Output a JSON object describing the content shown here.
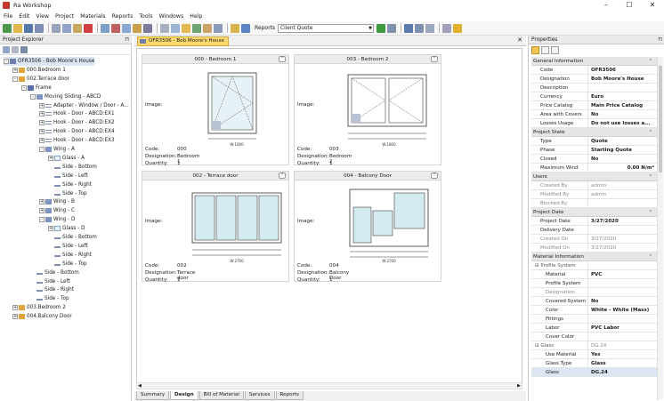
{
  "app": {
    "title": "Ra Workshop"
  },
  "window_controls": {
    "minimize": "–",
    "maximize": "☐",
    "close": "✕"
  },
  "menu": [
    "File",
    "Edit",
    "View",
    "Project",
    "Materials",
    "Reports",
    "Tools",
    "Windows",
    "Help"
  ],
  "toolbar": {
    "reports_label": "Reports",
    "report_select_value": "Client Quote"
  },
  "explorer": {
    "title": "Project Explorer",
    "tree": [
      {
        "label": "OFR3506 - Bob Moore's House",
        "level": 0,
        "icon": "project-icon",
        "expander": "-",
        "selected": true
      },
      {
        "label": "000.Bedroom 1",
        "level": 1,
        "icon": "window-icon",
        "expander": "+"
      },
      {
        "label": "002.Terrace door",
        "level": 1,
        "icon": "window-icon",
        "expander": "-"
      },
      {
        "label": "Frame",
        "level": 2,
        "icon": "frame-icon",
        "expander": "-"
      },
      {
        "label": "Moving Sliding - ABCD",
        "level": 3,
        "icon": "sash-icon",
        "expander": "-"
      },
      {
        "label": "Adapter - Window / Door - A...",
        "level": 4,
        "icon": "adapter-icon",
        "expander": "+"
      },
      {
        "label": "Hook - Door - ABCD:EX1",
        "level": 4,
        "icon": "adapter-icon",
        "expander": "+"
      },
      {
        "label": "Hook - Door - ABCD:EX2",
        "level": 4,
        "icon": "adapter-icon",
        "expander": "+"
      },
      {
        "label": "Hook - Door - ABCD:EX4",
        "level": 4,
        "icon": "adapter-icon",
        "expander": "+"
      },
      {
        "label": "Hook - Door - ABCD:EX3",
        "level": 4,
        "icon": "adapter-icon",
        "expander": "+"
      },
      {
        "label": "Wing - A",
        "level": 4,
        "icon": "sash-icon",
        "expander": "-"
      },
      {
        "label": "Glass - A",
        "level": 5,
        "icon": "glass-icon",
        "expander": "+"
      },
      {
        "label": "Side - Bottom",
        "level": 5,
        "icon": "side-icon",
        "expander": ""
      },
      {
        "label": "Side - Left",
        "level": 5,
        "icon": "side-icon",
        "expander": ""
      },
      {
        "label": "Side - Right",
        "level": 5,
        "icon": "side-icon",
        "expander": ""
      },
      {
        "label": "Side - Top",
        "level": 5,
        "icon": "side-icon",
        "expander": ""
      },
      {
        "label": "Wing - B",
        "level": 4,
        "icon": "sash-icon",
        "expander": "+"
      },
      {
        "label": "Wing - C",
        "level": 4,
        "icon": "sash-icon",
        "expander": "+"
      },
      {
        "label": "Wing - D",
        "level": 4,
        "icon": "sash-icon",
        "expander": "-"
      },
      {
        "label": "Glass - D",
        "level": 5,
        "icon": "glass-icon",
        "expander": "+"
      },
      {
        "label": "Side - Bottom",
        "level": 5,
        "icon": "side-icon",
        "expander": ""
      },
      {
        "label": "Side - Left",
        "level": 5,
        "icon": "side-icon",
        "expander": ""
      },
      {
        "label": "Side - Right",
        "level": 5,
        "icon": "side-icon",
        "expander": ""
      },
      {
        "label": "Side - Top",
        "level": 5,
        "icon": "side-icon",
        "expander": ""
      },
      {
        "label": "Side - Bottom",
        "level": 3,
        "icon": "side-icon",
        "expander": ""
      },
      {
        "label": "Side - Left",
        "level": 3,
        "icon": "side-icon",
        "expander": ""
      },
      {
        "label": "Side - Right",
        "level": 3,
        "icon": "side-icon",
        "expander": ""
      },
      {
        "label": "Side - Top",
        "level": 3,
        "icon": "side-icon",
        "expander": ""
      },
      {
        "label": "003.Bedroom 2",
        "level": 1,
        "icon": "window-icon",
        "expander": "+"
      },
      {
        "label": "004.Balcony Door",
        "level": 1,
        "icon": "window-icon",
        "expander": "+"
      }
    ]
  },
  "document": {
    "tab_label": "OFR3506 - Bob Moore's House",
    "close_glyph": "✕",
    "cards": [
      {
        "title": "000 - Bedroom 1",
        "image_label": "Image:",
        "code_label": "Code:",
        "code": "000",
        "designation_label": "Designation:",
        "designation": "Bedroom 1",
        "quantity_label": "Quantity:",
        "quantity": "1",
        "width_label": "W:1000"
      },
      {
        "title": "003 - Bedroom 2",
        "image_label": "Image:",
        "code_label": "Code:",
        "code": "003",
        "designation_label": "Designation:",
        "designation": "Bedroom 2",
        "quantity_label": "Quantity:",
        "quantity": "1",
        "width_label": "W:1800"
      },
      {
        "title": "002 - Terrace door",
        "image_label": "Image:",
        "code_label": "Code:",
        "code": "002",
        "designation_label": "Designation:",
        "designation": "Terrace door",
        "quantity_label": "Quantity:",
        "quantity": "1",
        "width_label": "W:2700"
      },
      {
        "title": "004 - Balcony Door",
        "image_label": "Image:",
        "code_label": "Code:",
        "code": "004",
        "designation_label": "Designation:",
        "designation": "Balcony Door",
        "quantity_label": "Quantity:",
        "quantity": "1",
        "width_label": "W:2700"
      }
    ],
    "bottom_tabs": [
      "Summary",
      "Design",
      "Bill of Material",
      "Services",
      "Reports"
    ],
    "active_tab": "Design"
  },
  "properties": {
    "title": "Properties",
    "sections": [
      {
        "title": "General Information",
        "rows": [
          {
            "key": "Code",
            "value": "OFR3506"
          },
          {
            "key": "Designation",
            "value": "Bob Moore's House"
          },
          {
            "key": "Description",
            "value": ""
          },
          {
            "key": "Currency",
            "value": "Euro"
          },
          {
            "key": "Price Catalog",
            "value": "Main Price Catalog"
          },
          {
            "key": "Area with Covers",
            "value": "No"
          },
          {
            "key": "Losses Usage Mode",
            "value": "Do not use losses a..."
          }
        ]
      },
      {
        "title": "Project State",
        "rows": [
          {
            "key": "Type",
            "value": "Quote"
          },
          {
            "key": "Phase",
            "value": "Starting Quote"
          },
          {
            "key": "Closed",
            "value": "No"
          },
          {
            "key": "Maximum Wind Press",
            "value": "0.00 N/m²",
            "align": "right"
          }
        ]
      },
      {
        "title": "Users",
        "rows": [
          {
            "key": "Created By",
            "value": "admin",
            "muted": true
          },
          {
            "key": "Modified By",
            "value": "admin",
            "muted": true
          },
          {
            "key": "Blocked By",
            "value": "",
            "muted": true
          }
        ]
      },
      {
        "title": "Project Date",
        "rows": [
          {
            "key": "Project Date",
            "value": "3/27/2020"
          },
          {
            "key": "Delivery Date",
            "value": ""
          },
          {
            "key": "Created On",
            "value": "3/27/2020",
            "muted": true
          },
          {
            "key": "Modified On",
            "value": "3/27/2020",
            "muted": true
          }
        ]
      },
      {
        "title": "Material Information",
        "rows": [
          {
            "key": "⊟ Profile System",
            "value": "",
            "sub": true
          },
          {
            "key": "Material",
            "value": "PVC",
            "indent": true
          },
          {
            "key": "Profile System",
            "value": "",
            "indent": true
          },
          {
            "key": "Designation",
            "value": "",
            "indent": true,
            "muted": true
          },
          {
            "key": "Covered System",
            "value": "No",
            "indent": true
          },
          {
            "key": "Color",
            "value": "White - White (Mass)",
            "indent": true
          },
          {
            "key": "Fittings",
            "value": "",
            "indent": true
          },
          {
            "key": "Labor",
            "value": "PVC Labor",
            "indent": true
          },
          {
            "key": "Cover Color",
            "value": "",
            "indent": true
          },
          {
            "key": "⊟ Glass",
            "value": "DG.24",
            "sub": true,
            "muted": true
          },
          {
            "key": "Use Material",
            "value": "Yes",
            "indent": true
          },
          {
            "key": "Glass Type",
            "value": "Glass",
            "indent": true
          },
          {
            "key": "Glass",
            "value": "DG.24",
            "indent": true,
            "selected": true
          }
        ]
      }
    ]
  },
  "colors": {
    "accent": "#fdd86e",
    "selection": "#dbe5f3",
    "header": "#eaeaea"
  }
}
